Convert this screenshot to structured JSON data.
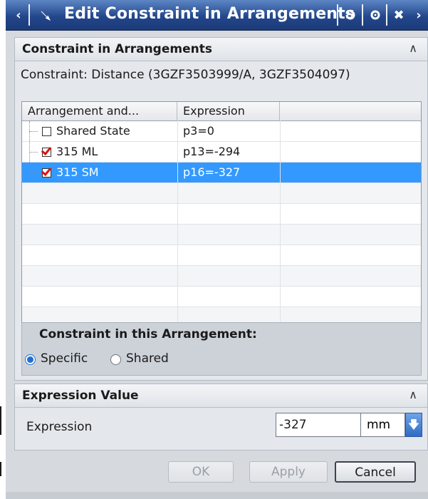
{
  "window": {
    "title": "Edit Constraint in Arrangements",
    "title_buttons": {
      "left_arrow": "<",
      "right_arrow": ">",
      "menu_icon": "flag-icon",
      "reset_icon": "reset-icon",
      "settings_icon": "gear-icon",
      "close_icon": "close-icon"
    }
  },
  "constraint_group": {
    "title": "Constraint in Arrangements",
    "constraint_text": "Constraint: Distance (3GZF3503999/A, 3GZF3504097)",
    "table": {
      "columns": [
        "Arrangement and...",
        "Expression"
      ],
      "rows": [
        {
          "name": "Shared State",
          "expression": "p3=0",
          "checked": false,
          "selected": false
        },
        {
          "name": "315 ML",
          "expression": "p13=-294",
          "checked": true,
          "selected": false
        },
        {
          "name": "315 SM",
          "expression": "p16=-327",
          "checked": true,
          "selected": true
        }
      ]
    },
    "arrangement_box": {
      "title": "Constraint in this Arrangement:",
      "options": [
        "Specific",
        "Shared"
      ],
      "selected": "Specific"
    }
  },
  "expression_group": {
    "title": "Expression Value",
    "label": "Expression",
    "value": "-327",
    "unit": "mm"
  },
  "buttons": {
    "ok": "OK",
    "apply": "Apply",
    "cancel": "Cancel"
  },
  "colors": {
    "titlebar": "#23478c",
    "selection": "#3399ff",
    "check": "#dd1111"
  }
}
